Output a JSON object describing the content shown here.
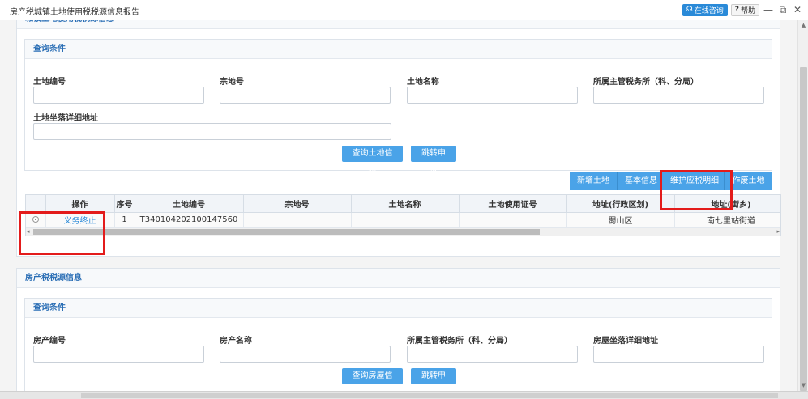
{
  "window": {
    "title": "房产税城镇土地使用税税源信息报告",
    "online_label": "在线咨询",
    "help_label": "帮助",
    "minimize_icon": "—",
    "restore_icon": "⧉",
    "close_icon": "✕"
  },
  "land_panel": {
    "title": "城镇土地使用税税源信息",
    "query": {
      "title": "查询条件",
      "labels": {
        "land_no": "土地编号",
        "parcel_no": "宗地号",
        "land_name": "土地名称",
        "tax_office": "所属主管税务所（科、分局）",
        "address": "土地坐落详细地址"
      },
      "values": {
        "land_no": "",
        "parcel_no": "",
        "land_name": "",
        "tax_office": "",
        "address": ""
      },
      "search_btn": "查询土地信息",
      "jump_btn": "跳转申报"
    },
    "toolbar": {
      "add": "新增土地",
      "basic": "基本信息",
      "maintain": "维护应税明细",
      "void": "作废土地"
    },
    "grid": {
      "columns": [
        "",
        "操作",
        "序号",
        "土地编号",
        "宗地号",
        "土地名称",
        "土地使用证号",
        "地址(行政区划)",
        "地址(街乡)"
      ],
      "rows": [
        {
          "action": "义务终止",
          "index": "1",
          "land_no": "T340104202100147560",
          "parcel_no": "",
          "land_name": "",
          "cert_no": "",
          "district": "蜀山区",
          "street": "南七里站街道"
        }
      ]
    }
  },
  "house_panel": {
    "title": "房产税税源信息",
    "query": {
      "title": "查询条件",
      "labels": {
        "house_no": "房产编号",
        "house_name": "房产名称",
        "tax_office": "所属主管税务所（科、分局）",
        "address": "房屋坐落详细地址"
      },
      "values": {
        "house_no": "",
        "house_name": "",
        "tax_office": "",
        "address": ""
      },
      "search_btn": "查询房屋信息",
      "jump_btn": "跳转申报"
    }
  },
  "colors": {
    "accent": "#4aa3e8",
    "header_text": "#2a6eb5",
    "highlight": "#e31b1b"
  }
}
